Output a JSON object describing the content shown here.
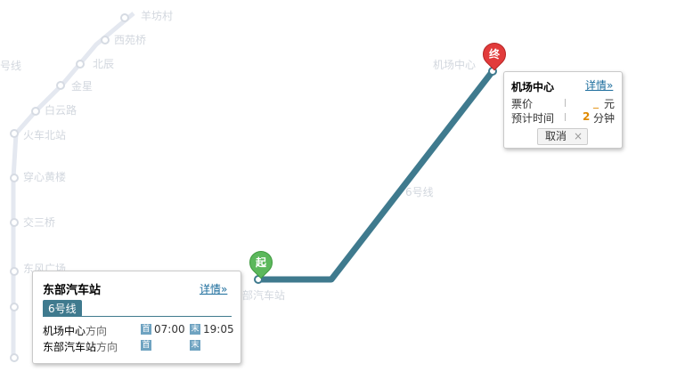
{
  "map": {
    "bg_labels": [
      "羊坊村",
      "西苑桥",
      "北辰",
      "金星",
      "白云路",
      "火车北站",
      "穿心黄楼",
      "交三桥",
      "东风广场",
      "号线",
      "6号线",
      "机场中心"
    ],
    "route_color": "#3f7a8e"
  },
  "start_marker": {
    "label": "起",
    "color": "#5cb85c"
  },
  "end_marker": {
    "label": "终",
    "color": "#e23b3b"
  },
  "start_popup": {
    "station": "东部汽车站",
    "detail_link": "详情»",
    "line_badge": "6号线",
    "directions": [
      {
        "station": "机场中心",
        "suffix": "方向",
        "first_tag": "首",
        "first_time": "07:00",
        "last_tag": "末",
        "last_time": "19:05"
      },
      {
        "station": "东部汽车站",
        "suffix": "方向",
        "first_tag": "首",
        "first_time": "",
        "last_tag": "末",
        "last_time": ""
      }
    ],
    "station_map_label": "部汽车站"
  },
  "end_popup": {
    "station": "机场中心",
    "detail_link": "详情»",
    "fare_label": "票价",
    "fare_value": "_",
    "fare_unit": "元",
    "time_label": "预计时间",
    "time_value": "2",
    "time_unit": "分钟",
    "cancel_label": "取消",
    "close_icon": "×"
  }
}
